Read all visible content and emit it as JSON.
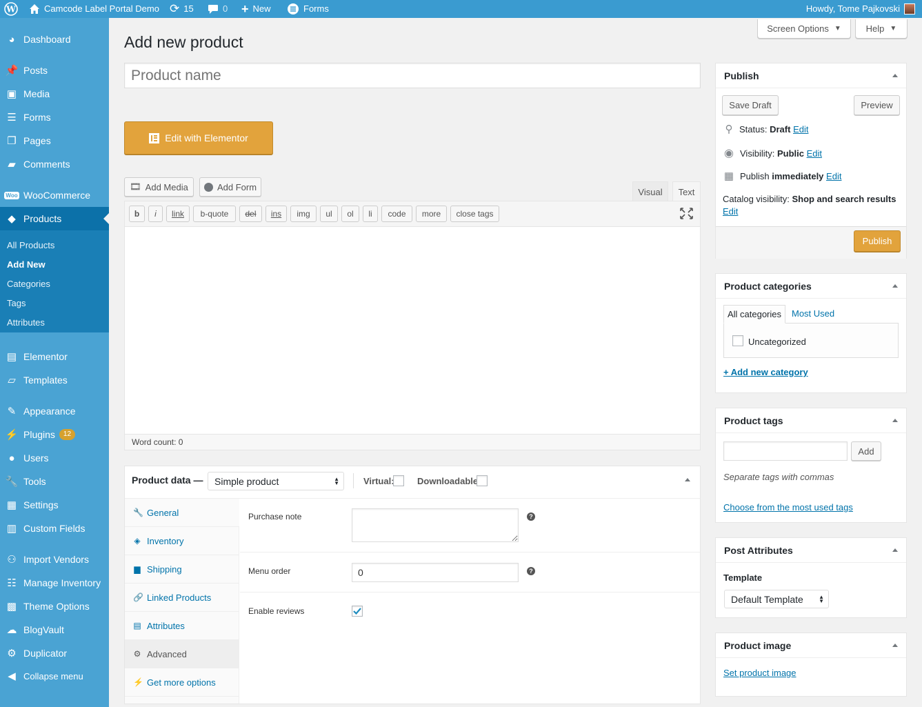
{
  "adminbar": {
    "site_name": "Camcode Label Portal Demo",
    "updates": "15",
    "comments": "0",
    "new": "New",
    "forms": "Forms",
    "greeting": "Howdy, Tome Pajkovski"
  },
  "sidebar": {
    "items": [
      {
        "label": "Dashboard",
        "icon": "dashboard-icon"
      },
      {
        "label": "Posts",
        "icon": "pin-icon"
      },
      {
        "label": "Media",
        "icon": "media-icon"
      },
      {
        "label": "Forms",
        "icon": "forms-icon"
      },
      {
        "label": "Pages",
        "icon": "pages-icon"
      },
      {
        "label": "Comments",
        "icon": "comment-icon"
      },
      {
        "label": "WooCommerce",
        "icon": "woo-icon"
      },
      {
        "label": "Products",
        "icon": "products-icon"
      },
      {
        "label": "Elementor",
        "icon": "elementor-icon"
      },
      {
        "label": "Templates",
        "icon": "folder-icon"
      },
      {
        "label": "Appearance",
        "icon": "brush-icon"
      },
      {
        "label": "Plugins",
        "icon": "plugin-icon",
        "badge": "12"
      },
      {
        "label": "Users",
        "icon": "user-icon"
      },
      {
        "label": "Tools",
        "icon": "wrench-icon"
      },
      {
        "label": "Settings",
        "icon": "settings-icon"
      },
      {
        "label": "Custom Fields",
        "icon": "table-icon"
      },
      {
        "label": "Import Vendors",
        "icon": "groups-icon"
      },
      {
        "label": "Manage Inventory",
        "icon": "list-icon"
      },
      {
        "label": "Theme Options",
        "icon": "layout-icon"
      },
      {
        "label": "BlogVault",
        "icon": "cloud-icon"
      },
      {
        "label": "Duplicator",
        "icon": "gear-icon"
      },
      {
        "label": "Collapse menu",
        "icon": "collapse-icon"
      }
    ],
    "submenu": [
      "All Products",
      "Add New",
      "Categories",
      "Tags",
      "Attributes"
    ]
  },
  "header": {
    "screen_options": "Screen Options",
    "help": "Help",
    "page_title": "Add new product",
    "title_placeholder": "Product name"
  },
  "editor": {
    "elementor_button": "Edit with Elementor",
    "add_media": "Add Media",
    "add_form": "Add Form",
    "tab_visual": "Visual",
    "tab_text": "Text",
    "quicktags": [
      "b",
      "i",
      "link",
      "b-quote",
      "del",
      "ins",
      "img",
      "ul",
      "ol",
      "li",
      "code",
      "more",
      "close tags"
    ],
    "word_count": "Word count: 0"
  },
  "product_data": {
    "title": "Product data —",
    "type": "Simple product",
    "virtual_label": "Virtual:",
    "downloadable_label": "Downloadable:",
    "tabs": [
      "General",
      "Inventory",
      "Shipping",
      "Linked Products",
      "Attributes",
      "Advanced",
      "Get more options"
    ],
    "active_tab": "Advanced",
    "purchase_note_label": "Purchase note",
    "menu_order_label": "Menu order",
    "menu_order_value": "0",
    "enable_reviews_label": "Enable reviews",
    "enable_reviews_checked": true
  },
  "publish": {
    "title": "Publish",
    "save_draft": "Save Draft",
    "preview": "Preview",
    "status_label": "Status:",
    "status_value": "Draft",
    "visibility_label": "Visibility:",
    "visibility_value": "Public",
    "publish_label": "Publish",
    "publish_value": "immediately",
    "edit": "Edit",
    "catalog_label": "Catalog visibility:",
    "catalog_value": "Shop and search results",
    "publish_button": "Publish"
  },
  "categories": {
    "title": "Product categories",
    "tab_all": "All categories",
    "tab_most_used": "Most Used",
    "items": [
      "Uncategorized"
    ],
    "add_new": "+ Add new category"
  },
  "tags": {
    "title": "Product tags",
    "add_button": "Add",
    "hint": "Separate tags with commas",
    "choose_link": "Choose from the most used tags"
  },
  "attributes_box": {
    "title": "Post Attributes",
    "template_label": "Template",
    "template_value": "Default Template"
  },
  "image_box": {
    "title": "Product image",
    "set_link": "Set product image"
  },
  "colors": {
    "adminbar": "#3a9bd0",
    "sidebar": "#4aa3d3",
    "sidebar_current": "#0c71a9",
    "accent_button": "#e2a33c",
    "link": "#0073aa"
  }
}
